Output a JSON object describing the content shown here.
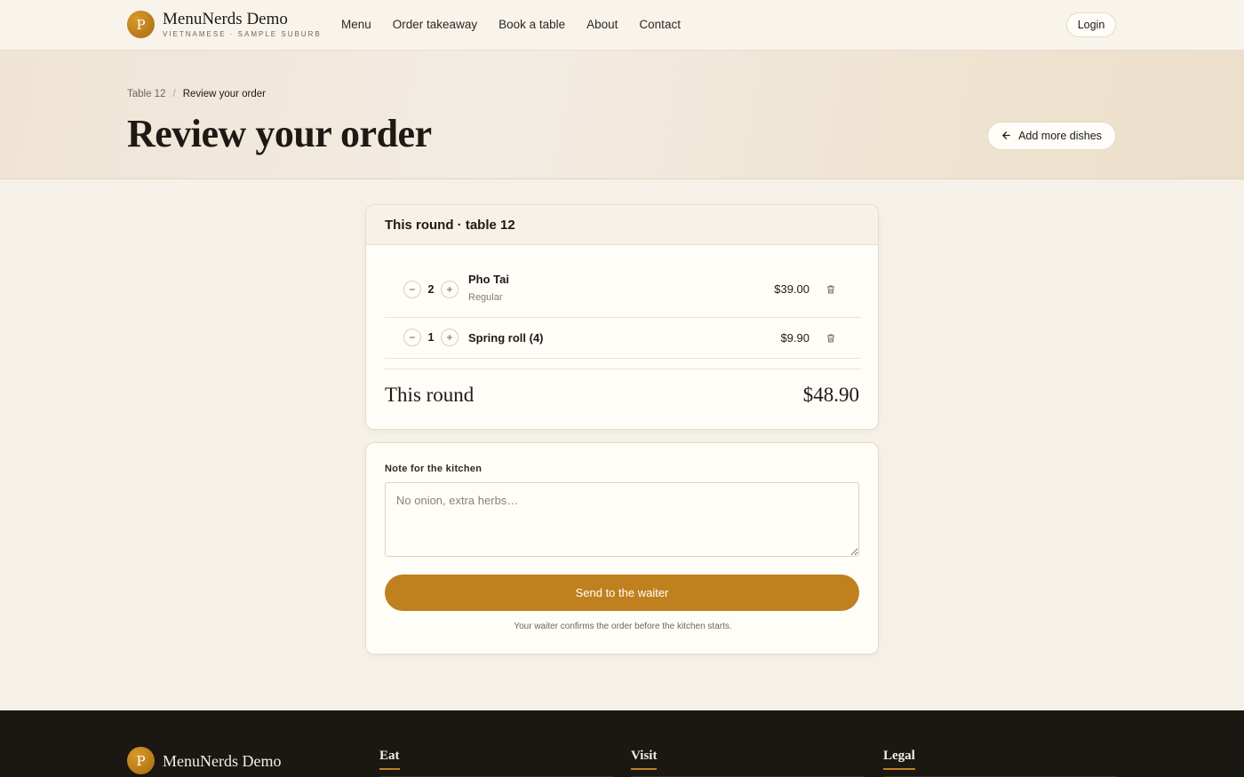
{
  "header": {
    "logo_letter": "P",
    "brand_name": "MenuNerds Demo",
    "brand_tagline": "VIETNAMESE · SAMPLE SUBURB",
    "nav": [
      "Menu",
      "Order takeaway",
      "Book a table",
      "About",
      "Contact"
    ],
    "login_label": "Login"
  },
  "hero": {
    "breadcrumb": [
      "Table 12",
      "Review your order"
    ],
    "breadcrumb_sep": "/",
    "title": "Review your order",
    "add_more_label": "Add more dishes"
  },
  "order": {
    "heading": "This round · table 12",
    "items": [
      {
        "qty": "2",
        "name": "Pho Tai",
        "variant": "Regular",
        "price": "$39.00"
      },
      {
        "qty": "1",
        "name": "Spring roll (4)",
        "variant": "",
        "price": "$9.90"
      }
    ],
    "total_label": "This round",
    "total_value": "$48.90"
  },
  "note": {
    "label": "Note for the kitchen",
    "placeholder": "No onion, extra herbs…",
    "send_label": "Send to the waiter",
    "hint": "Your waiter confirms the order before the kitchen starts."
  },
  "footer": {
    "logo_letter": "P",
    "brand_name": "MenuNerds Demo",
    "columns": [
      "Eat",
      "Visit",
      "Legal"
    ]
  },
  "colors": {
    "accent": "#c0801d",
    "background": "#f6f1e8",
    "footer": "#1b1712"
  },
  "icons": {
    "back": "arrow-left-icon",
    "remove": "trash-icon",
    "decrement": "minus-icon",
    "increment": "plus-icon"
  }
}
